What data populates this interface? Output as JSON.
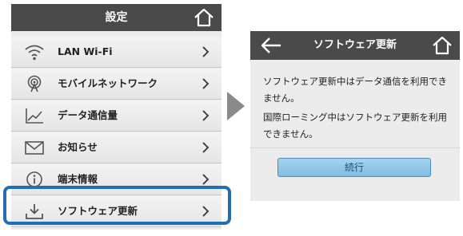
{
  "settings_screen": {
    "title": "設定",
    "items": [
      {
        "label": "LAN Wi-Fi",
        "icon": "wifi-icon"
      },
      {
        "label": "モバイルネットワーク",
        "icon": "mobile-network-icon"
      },
      {
        "label": "データ通信量",
        "icon": "data-usage-icon"
      },
      {
        "label": "お知らせ",
        "icon": "mail-icon"
      },
      {
        "label": "端末情報",
        "icon": "info-icon"
      },
      {
        "label": "ソフトウェア更新",
        "icon": "download-icon"
      }
    ],
    "highlighted_item": "ソフトウェア更新"
  },
  "update_screen": {
    "title": "ソフトウェア更新",
    "message_1": "ソフトウェア更新中はデータ通信を利用できません。",
    "message_2": "国際ローミング中はソフトウェア更新を利用できません。",
    "continue_label": "続行"
  },
  "colors": {
    "topbar": "#4a4a4a",
    "panel": "#ececec",
    "highlight": "#1f6fb2",
    "button": "#8fc6e6",
    "arrow": "#8a8a8a"
  }
}
